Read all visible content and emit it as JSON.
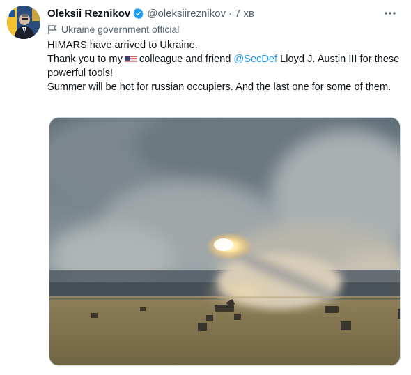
{
  "tweet": {
    "display_name": "Oleksii Reznikov",
    "handle": "@oleksiireznikov",
    "separator": "·",
    "time": "7 хв",
    "label": "Ukraine government official",
    "text": {
      "line1": "HIMARS have arrived to Ukraine.",
      "line2_before_flag": "Thank you to my",
      "line2_after_flag": "colleague and friend",
      "mention": "@SecDef",
      "line2_rest": "Lloyd J. Austin III for these powerful tools!",
      "line3": "Summer will be hot for russian occupiers. And the last one for some of them."
    }
  },
  "icons": {
    "verified": "verified-badge-icon",
    "more": "more-options-icon",
    "flag": "government-flag-icon",
    "us_flag": "us-flag-emoji"
  },
  "colors": {
    "accent": "#1d9bf0",
    "secondary_text": "#536471",
    "primary_text": "#0f1419"
  }
}
